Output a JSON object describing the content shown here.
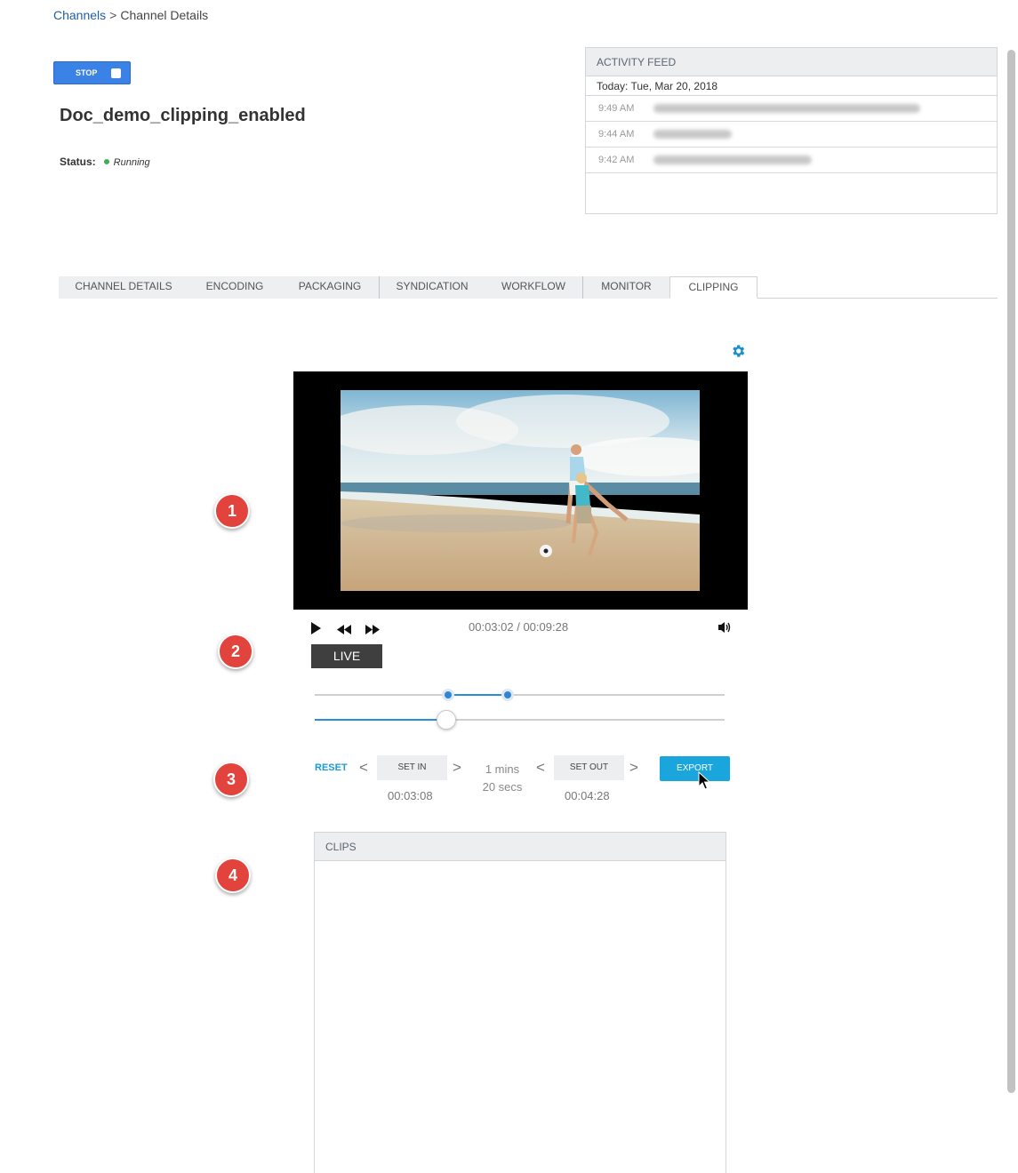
{
  "breadcrumb": {
    "root": "Channels",
    "separator": ">",
    "current": "Channel Details"
  },
  "toolbar": {
    "stop_label": "STOP"
  },
  "channel": {
    "name": "Doc_demo_clipping_enabled",
    "status_label": "Status:",
    "status_value": "Running",
    "status_color": "#3cb054"
  },
  "activity_feed": {
    "title": "ACTIVITY FEED",
    "date": "Today: Tue, Mar 20, 2018",
    "entries": [
      {
        "time": "9:49 AM"
      },
      {
        "time": "9:44 AM"
      },
      {
        "time": "9:42 AM"
      }
    ]
  },
  "tabs": [
    {
      "label": "CHANNEL DETAILS"
    },
    {
      "label": "ENCODING"
    },
    {
      "label": "PACKAGING"
    },
    {
      "label": "SYNDICATION"
    },
    {
      "label": "WORKFLOW"
    },
    {
      "label": "MONITOR"
    },
    {
      "label": "CLIPPING",
      "active": true
    }
  ],
  "player": {
    "current_time": "00:03:02",
    "total_time": "00:09:28",
    "timecode": "00:03:02 / 00:09:28",
    "live_label": "LIVE",
    "clip_range": {
      "start_fraction": 0.325,
      "end_fraction": 0.47
    },
    "playhead_fraction": 0.32
  },
  "clip_controls": {
    "reset_label": "RESET",
    "prev_symbol": "<",
    "next_symbol": ">",
    "set_in_label": "SET IN",
    "set_in_time": "00:03:08",
    "duration_line1": "1 mins",
    "duration_line2": "20 secs",
    "set_out_label": "SET OUT",
    "set_out_time": "00:04:28",
    "export_label": "EXPORT"
  },
  "clips": {
    "title": "CLIPS"
  },
  "callouts": [
    "1",
    "2",
    "3",
    "4"
  ],
  "colors": {
    "accent": "#1aa6dc",
    "stop_button": "#3b82e6",
    "callout": "#e2433c",
    "link": "#1f5fa8"
  }
}
